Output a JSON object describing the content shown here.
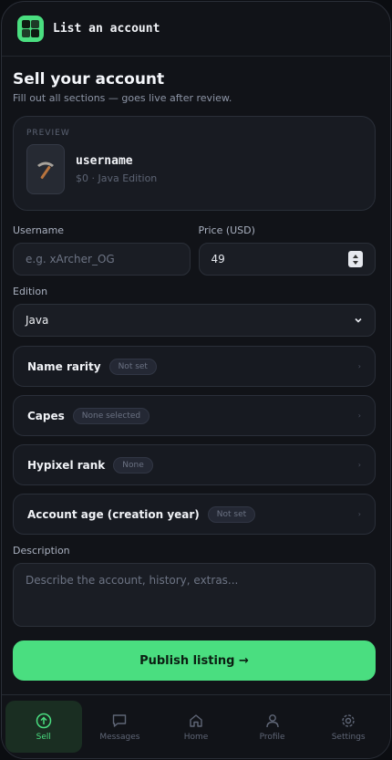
{
  "header": {
    "app_title": "List an account",
    "logo_icon": "grid-logo-icon"
  },
  "page": {
    "title": "Sell your account",
    "subtitle": "Fill out all sections — goes live after review."
  },
  "preview": {
    "tag": "PREVIEW",
    "icon": "pickaxe-icon",
    "name": "username",
    "meta": "$0 · Java Edition"
  },
  "form": {
    "username_label": "Username",
    "username_placeholder": "e.g. xArcher_OG",
    "price_label": "Price (USD)",
    "price_value": "49",
    "edition_label": "Edition",
    "edition_value": "Java",
    "description_label": "Description",
    "description_placeholder": "Describe the account, history, extras..."
  },
  "sections": [
    {
      "title": "Name rarity",
      "badge": "Not set"
    },
    {
      "title": "Capes",
      "badge": "None selected"
    },
    {
      "title": "Hypixel rank",
      "badge": "None"
    },
    {
      "title": "Account age (creation year)",
      "badge": "Not set"
    }
  ],
  "publish_label": "Publish listing →",
  "nav": {
    "items": [
      {
        "label": "Sell",
        "icon": "arrow-up-circle-icon",
        "active": true
      },
      {
        "label": "Messages",
        "icon": "chat-bubble-icon"
      },
      {
        "label": "Home",
        "icon": "home-icon"
      },
      {
        "label": "Profile",
        "icon": "person-icon"
      },
      {
        "label": "Settings",
        "icon": "gear-icon"
      }
    ]
  },
  "colors": {
    "accent": "#4ade80",
    "background": "#111318",
    "card": "#181b22"
  }
}
